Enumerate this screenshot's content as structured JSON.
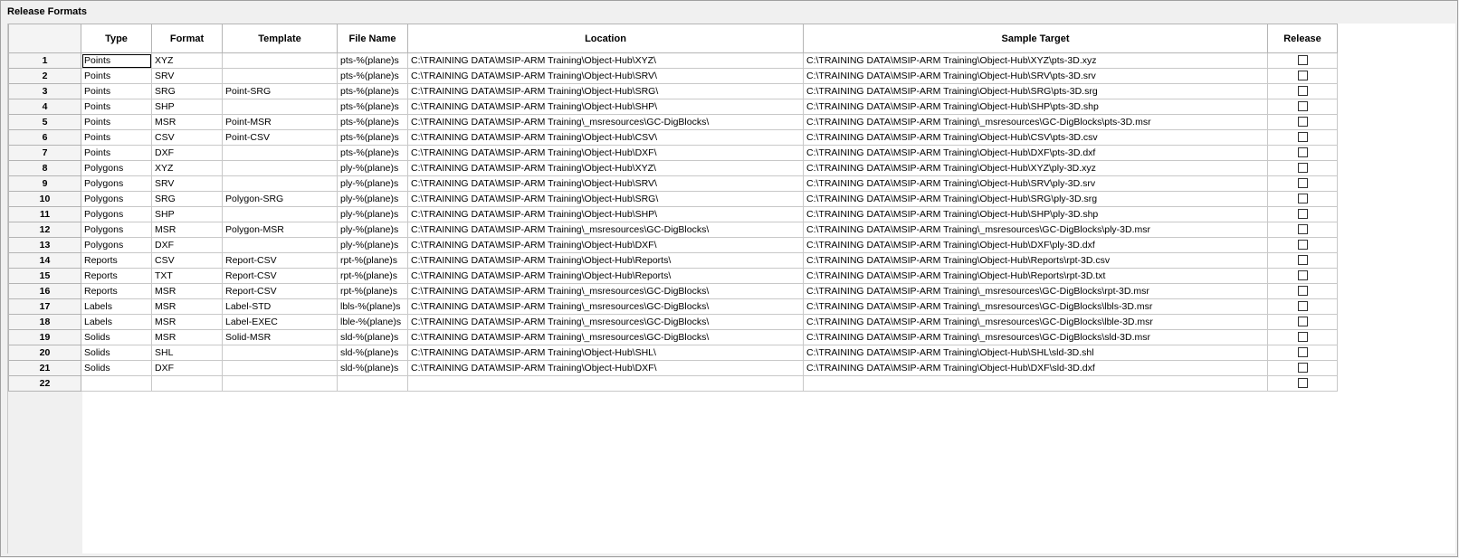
{
  "window": {
    "title": "Release Formats"
  },
  "grid": {
    "columns": [
      "Type",
      "Format",
      "Template",
      "File Name",
      "Location",
      "Sample Target",
      "Release"
    ],
    "rows": [
      {
        "num": "1",
        "type": "Points",
        "format": "XYZ",
        "template": "",
        "file_name": "pts-%(plane)s",
        "location": "C:\\TRAINING DATA\\MSIP-ARM Training\\Object-Hub\\XYZ\\",
        "sample_target": "C:\\TRAINING DATA\\MSIP-ARM Training\\Object-Hub\\XYZ\\pts-3D.xyz",
        "release": false
      },
      {
        "num": "2",
        "type": "Points",
        "format": "SRV",
        "template": "",
        "file_name": "pts-%(plane)s",
        "location": "C:\\TRAINING DATA\\MSIP-ARM Training\\Object-Hub\\SRV\\",
        "sample_target": "C:\\TRAINING DATA\\MSIP-ARM Training\\Object-Hub\\SRV\\pts-3D.srv",
        "release": false
      },
      {
        "num": "3",
        "type": "Points",
        "format": "SRG",
        "template": "Point-SRG",
        "file_name": "pts-%(plane)s",
        "location": "C:\\TRAINING DATA\\MSIP-ARM Training\\Object-Hub\\SRG\\",
        "sample_target": "C:\\TRAINING DATA\\MSIP-ARM Training\\Object-Hub\\SRG\\pts-3D.srg",
        "release": false
      },
      {
        "num": "4",
        "type": "Points",
        "format": "SHP",
        "template": "",
        "file_name": "pts-%(plane)s",
        "location": "C:\\TRAINING DATA\\MSIP-ARM Training\\Object-Hub\\SHP\\",
        "sample_target": "C:\\TRAINING DATA\\MSIP-ARM Training\\Object-Hub\\SHP\\pts-3D.shp",
        "release": false
      },
      {
        "num": "5",
        "type": "Points",
        "format": "MSR",
        "template": "Point-MSR",
        "file_name": "pts-%(plane)s",
        "location": "C:\\TRAINING DATA\\MSIP-ARM Training\\_msresources\\GC-DigBlocks\\",
        "sample_target": "C:\\TRAINING DATA\\MSIP-ARM Training\\_msresources\\GC-DigBlocks\\pts-3D.msr",
        "release": false
      },
      {
        "num": "6",
        "type": "Points",
        "format": "CSV",
        "template": "Point-CSV",
        "file_name": "pts-%(plane)s",
        "location": "C:\\TRAINING DATA\\MSIP-ARM Training\\Object-Hub\\CSV\\",
        "sample_target": "C:\\TRAINING DATA\\MSIP-ARM Training\\Object-Hub\\CSV\\pts-3D.csv",
        "release": false
      },
      {
        "num": "7",
        "type": "Points",
        "format": "DXF",
        "template": "",
        "file_name": "pts-%(plane)s",
        "location": "C:\\TRAINING DATA\\MSIP-ARM Training\\Object-Hub\\DXF\\",
        "sample_target": "C:\\TRAINING DATA\\MSIP-ARM Training\\Object-Hub\\DXF\\pts-3D.dxf",
        "release": false
      },
      {
        "num": "8",
        "type": "Polygons",
        "format": "XYZ",
        "template": "",
        "file_name": "ply-%(plane)s",
        "location": "C:\\TRAINING DATA\\MSIP-ARM Training\\Object-Hub\\XYZ\\",
        "sample_target": "C:\\TRAINING DATA\\MSIP-ARM Training\\Object-Hub\\XYZ\\ply-3D.xyz",
        "release": false
      },
      {
        "num": "9",
        "type": "Polygons",
        "format": "SRV",
        "template": "",
        "file_name": "ply-%(plane)s",
        "location": "C:\\TRAINING DATA\\MSIP-ARM Training\\Object-Hub\\SRV\\",
        "sample_target": "C:\\TRAINING DATA\\MSIP-ARM Training\\Object-Hub\\SRV\\ply-3D.srv",
        "release": false
      },
      {
        "num": "10",
        "type": "Polygons",
        "format": "SRG",
        "template": "Polygon-SRG",
        "file_name": "ply-%(plane)s",
        "location": "C:\\TRAINING DATA\\MSIP-ARM Training\\Object-Hub\\SRG\\",
        "sample_target": "C:\\TRAINING DATA\\MSIP-ARM Training\\Object-Hub\\SRG\\ply-3D.srg",
        "release": false
      },
      {
        "num": "11",
        "type": "Polygons",
        "format": "SHP",
        "template": "",
        "file_name": "ply-%(plane)s",
        "location": "C:\\TRAINING DATA\\MSIP-ARM Training\\Object-Hub\\SHP\\",
        "sample_target": "C:\\TRAINING DATA\\MSIP-ARM Training\\Object-Hub\\SHP\\ply-3D.shp",
        "release": false
      },
      {
        "num": "12",
        "type": "Polygons",
        "format": "MSR",
        "template": "Polygon-MSR",
        "file_name": "ply-%(plane)s",
        "location": "C:\\TRAINING DATA\\MSIP-ARM Training\\_msresources\\GC-DigBlocks\\",
        "sample_target": "C:\\TRAINING DATA\\MSIP-ARM Training\\_msresources\\GC-DigBlocks\\ply-3D.msr",
        "release": false
      },
      {
        "num": "13",
        "type": "Polygons",
        "format": "DXF",
        "template": "",
        "file_name": "ply-%(plane)s",
        "location": "C:\\TRAINING DATA\\MSIP-ARM Training\\Object-Hub\\DXF\\",
        "sample_target": "C:\\TRAINING DATA\\MSIP-ARM Training\\Object-Hub\\DXF\\ply-3D.dxf",
        "release": false
      },
      {
        "num": "14",
        "type": "Reports",
        "format": "CSV",
        "template": "Report-CSV",
        "file_name": "rpt-%(plane)s",
        "location": "C:\\TRAINING DATA\\MSIP-ARM Training\\Object-Hub\\Reports\\",
        "sample_target": "C:\\TRAINING DATA\\MSIP-ARM Training\\Object-Hub\\Reports\\rpt-3D.csv",
        "release": false
      },
      {
        "num": "15",
        "type": "Reports",
        "format": "TXT",
        "template": "Report-CSV",
        "file_name": "rpt-%(plane)s",
        "location": "C:\\TRAINING DATA\\MSIP-ARM Training\\Object-Hub\\Reports\\",
        "sample_target": "C:\\TRAINING DATA\\MSIP-ARM Training\\Object-Hub\\Reports\\rpt-3D.txt",
        "release": false
      },
      {
        "num": "16",
        "type": "Reports",
        "format": "MSR",
        "template": "Report-CSV",
        "file_name": "rpt-%(plane)s",
        "location": "C:\\TRAINING DATA\\MSIP-ARM Training\\_msresources\\GC-DigBlocks\\",
        "sample_target": "C:\\TRAINING DATA\\MSIP-ARM Training\\_msresources\\GC-DigBlocks\\rpt-3D.msr",
        "release": false
      },
      {
        "num": "17",
        "type": "Labels",
        "format": "MSR",
        "template": "Label-STD",
        "file_name": "lbls-%(plane)s",
        "location": "C:\\TRAINING DATA\\MSIP-ARM Training\\_msresources\\GC-DigBlocks\\",
        "sample_target": "C:\\TRAINING DATA\\MSIP-ARM Training\\_msresources\\GC-DigBlocks\\lbls-3D.msr",
        "release": false
      },
      {
        "num": "18",
        "type": "Labels",
        "format": "MSR",
        "template": "Label-EXEC",
        "file_name": "lble-%(plane)s",
        "location": "C:\\TRAINING DATA\\MSIP-ARM Training\\_msresources\\GC-DigBlocks\\",
        "sample_target": "C:\\TRAINING DATA\\MSIP-ARM Training\\_msresources\\GC-DigBlocks\\lble-3D.msr",
        "release": false
      },
      {
        "num": "19",
        "type": "Solids",
        "format": "MSR",
        "template": "Solid-MSR",
        "file_name": "sld-%(plane)s",
        "location": "C:\\TRAINING DATA\\MSIP-ARM Training\\_msresources\\GC-DigBlocks\\",
        "sample_target": "C:\\TRAINING DATA\\MSIP-ARM Training\\_msresources\\GC-DigBlocks\\sld-3D.msr",
        "release": false
      },
      {
        "num": "20",
        "type": "Solids",
        "format": "SHL",
        "template": "",
        "file_name": "sld-%(plane)s",
        "location": "C:\\TRAINING DATA\\MSIP-ARM Training\\Object-Hub\\SHL\\",
        "sample_target": "C:\\TRAINING DATA\\MSIP-ARM Training\\Object-Hub\\SHL\\sld-3D.shl",
        "release": false
      },
      {
        "num": "21",
        "type": "Solids",
        "format": "DXF",
        "template": "",
        "file_name": "sld-%(plane)s",
        "location": "C:\\TRAINING DATA\\MSIP-ARM Training\\Object-Hub\\DXF\\",
        "sample_target": "C:\\TRAINING DATA\\MSIP-ARM Training\\Object-Hub\\DXF\\sld-3D.dxf",
        "release": false
      },
      {
        "num": "22",
        "type": "",
        "format": "",
        "template": "",
        "file_name": "",
        "location": "",
        "sample_target": "",
        "release": false
      }
    ]
  }
}
